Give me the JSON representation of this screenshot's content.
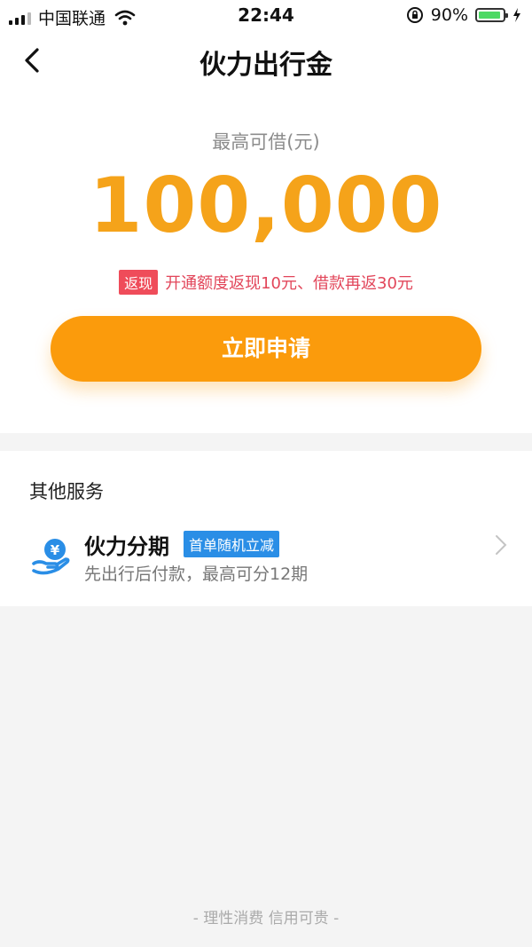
{
  "status_bar": {
    "carrier": "中国联通",
    "time": "22:44",
    "battery": "90%",
    "battery_level": 0.9,
    "icons": [
      "signal-icon",
      "wifi-icon",
      "rotation-lock-icon",
      "battery-icon",
      "charging-icon"
    ]
  },
  "nav": {
    "title": "伙力出行金",
    "back_icon": "back-chevron-icon"
  },
  "hero": {
    "limit_label": "最高可借(元)",
    "amount": "100,000",
    "promo_badge": "返现",
    "promo_text": "开通额度返现10元、借款再返30元",
    "apply_label": "立即申请"
  },
  "services": {
    "title": "其他服务",
    "items": [
      {
        "name": "伙力分期",
        "tag": "首单随机立减",
        "desc": "先出行后付款，最高可分12期",
        "icon": "yen-hand-icon"
      }
    ]
  },
  "footer": {
    "text": "- 理性消费 信用可贵 -"
  },
  "colors": {
    "accent": "#fb9b0c",
    "amount": "#f5a31a",
    "promo": "#ef4c5a",
    "tag": "#2a8ee6"
  }
}
